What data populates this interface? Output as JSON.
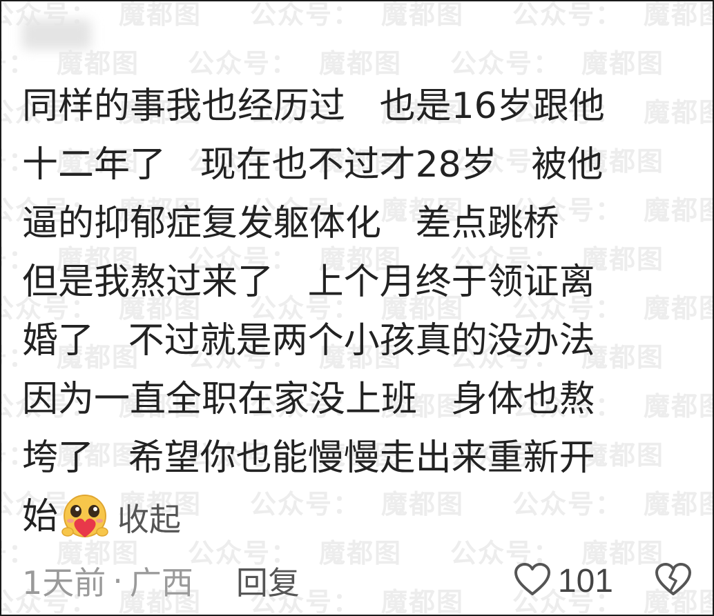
{
  "watermark": {
    "text_a": "公众号",
    "text_b": "魔都图"
  },
  "comment": {
    "lines": [
      "同样的事我也经历过   也是16岁跟他",
      "十二年了   现在也不过才28岁   被他",
      "逼的抑郁症复发躯体化   差点跳桥",
      "但是我熬过来了   上个月终于领证离",
      "婚了   不过就是两个小孩真的没办法",
      "因为一直全职在家没上班   身体也熬",
      "垮了   希望你也能慢慢走出来重新开"
    ],
    "last_text": "始",
    "emoji_icon": "heart-face-emoji-icon",
    "collapse_label": "收起"
  },
  "footer": {
    "time": "1天前",
    "separator": "·",
    "location": "广西",
    "reply_label": "回复",
    "like_count": "101",
    "like_icon": "heart-outline-icon",
    "dislike_icon": "broken-heart-icon"
  },
  "colors": {
    "text": "#222222",
    "meta": "#9a9a9a",
    "emoji_face": "#f7c64b",
    "emoji_heart": "#e8384a"
  }
}
